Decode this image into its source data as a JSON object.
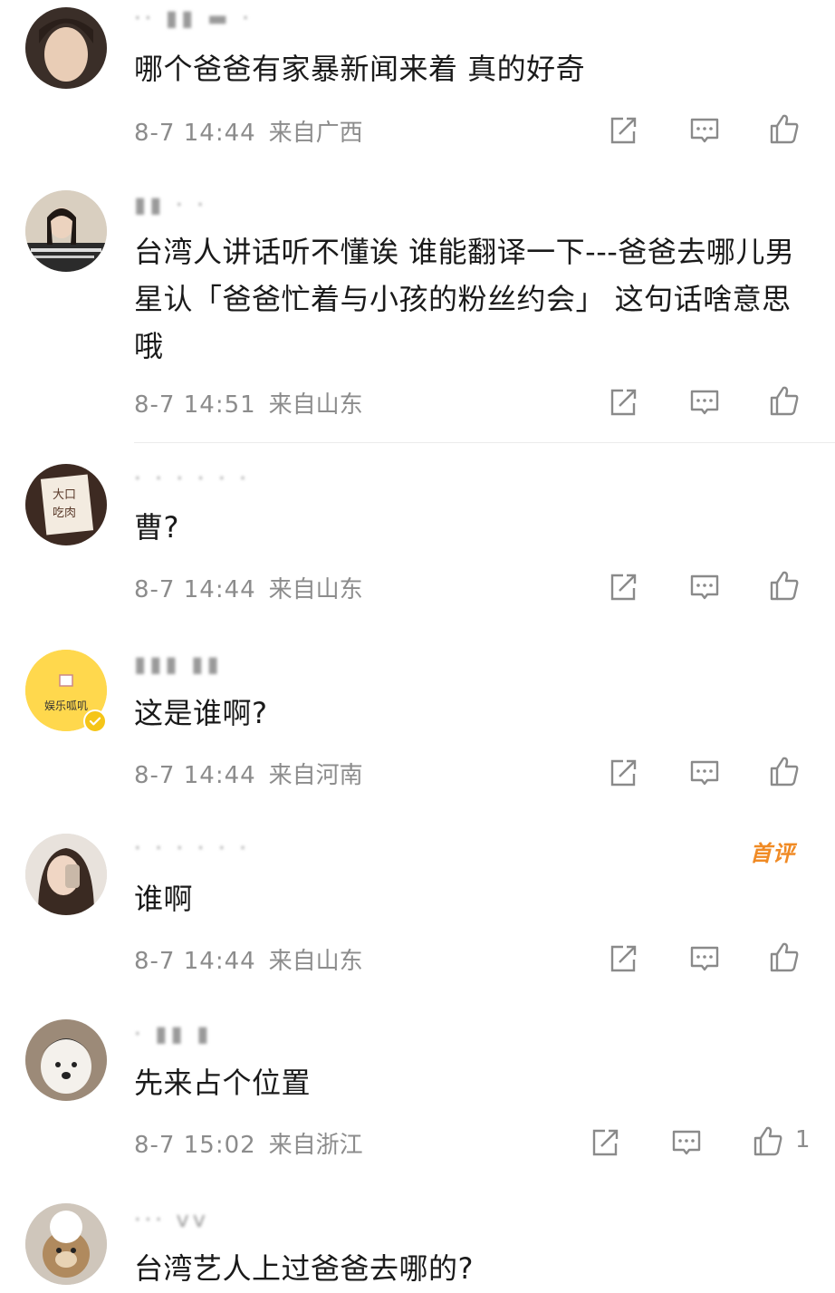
{
  "comments": [
    {
      "username": "·· ▮▮ ▬ ·",
      "text": "哪个爸爸有家暴新闻来着 真的好奇",
      "time": "8-7 14:44",
      "location": "来自广西"
    },
    {
      "username": "▮▮ · ·",
      "text": "台湾人讲话听不懂诶 谁能翻译一下---爸爸去哪儿男星认「爸爸忙着与小孩的粉丝约会」 这句话啥意思哦",
      "time": "8-7 14:51",
      "location": "来自山东"
    },
    {
      "username": "· · · · · ·",
      "text": "曹?",
      "time": "8-7 14:44",
      "location": "来自山东"
    },
    {
      "username": "▮▮▮  ▮▮",
      "text": "这是谁啊?",
      "time": "8-7 14:44",
      "location": "来自河南",
      "avatar_text": "娱乐呱叽"
    },
    {
      "username": "· · · · · ·",
      "text": "谁啊",
      "time": "8-7 14:44",
      "location": "来自山东",
      "badge": "首评"
    },
    {
      "username": "·  ▮▮ ▮",
      "text": "先来占个位置",
      "time": "8-7 15:02",
      "location": "来自浙江",
      "likes": "1"
    },
    {
      "username": "··· vv",
      "text": "台湾艺人上过爸爸去哪的?"
    }
  ],
  "icons": {
    "share": "share-icon",
    "reply": "comment-icon",
    "like": "thumbs-up-icon",
    "verified": "verified-badge-icon"
  },
  "colors": {
    "text": "#1a1a1a",
    "meta": "#8c8c8c",
    "first_badge": "#f08a24",
    "verified": "#f5c518"
  }
}
